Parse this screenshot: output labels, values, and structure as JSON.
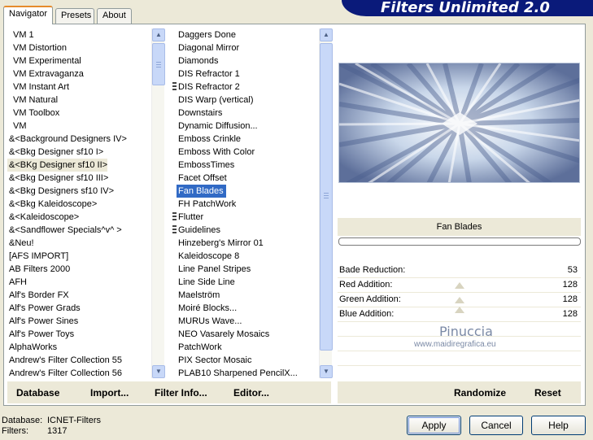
{
  "tabs": [
    {
      "label": "Navigator"
    },
    {
      "label": "Presets"
    },
    {
      "label": "About"
    }
  ],
  "banner_title": "Filters Unlimited 2.0",
  "categories": [
    "VM 1",
    "VM Distortion",
    "VM Experimental",
    "VM Extravaganza",
    "VM Instant Art",
    "VM Natural",
    "VM Toolbox",
    "VM",
    "&<Background Designers IV>",
    "&<Bkg Designer sf10 I>",
    "&<BKg Designer sf10 II>",
    "&<Bkg Designer sf10 III>",
    "&<Bkg Designers sf10 IV>",
    "&<Bkg Kaleidoscope>",
    "&<Kaleidoscope>",
    "&<Sandflower Specials^v^ >",
    "&Neu!",
    "[AFS IMPORT]",
    "AB Filters 2000",
    "AFH",
    "Alf's Border FX",
    "Alf's Power Grads",
    "Alf's Power Sines",
    "Alf's Power Toys",
    "AlphaWorks",
    "Andrew's Filter Collection 55",
    "Andrew's Filter Collection 56"
  ],
  "filters": [
    "Daggers Done",
    "Diagonal Mirror",
    "Diamonds",
    "DIS Refractor 1",
    "DIS Refractor 2",
    "DIS Warp (vertical)",
    "Downstairs",
    "Dynamic Diffusion...",
    "Emboss Crinkle",
    "Emboss With Color",
    "EmbossTimes",
    "Facet Offset",
    "Fan Blades",
    "FH PatchWork",
    "Flutter",
    "Guidelines",
    "Hinzeberg's Mirror 01",
    "Kaleidoscope 8",
    "Line Panel Stripes",
    "Line Side Line",
    "Maelström",
    "Moiré Blocks...",
    "MURUs Wave...",
    "NEO Vasarely Mosaics",
    "PatchWork",
    "PIX Sector Mosaic",
    "PLAB10 Sharpened PencilX..."
  ],
  "filter_name": "Fan Blades",
  "params": [
    {
      "label": "Bade Reduction:",
      "value": "53"
    },
    {
      "label": "Red Addition:",
      "value": "128"
    },
    {
      "label": "Green Addition:",
      "value": "128"
    },
    {
      "label": "Blue Addition:",
      "value": "128"
    }
  ],
  "watermark": {
    "line1": "Pinuccia",
    "line2": "www.maidiregrafica.eu"
  },
  "bottom_left": {
    "database": "Database",
    "import": "Import...",
    "filter_info": "Filter Info...",
    "editor": "Editor..."
  },
  "bottom_right": {
    "randomize": "Randomize",
    "reset": "Reset"
  },
  "status": {
    "db_label": "Database:",
    "db_value": "ICNET-Filters",
    "filters_label": "Filters:",
    "filters_value": "1317"
  },
  "buttons": {
    "apply": "Apply",
    "cancel": "Cancel",
    "help": "Help"
  }
}
